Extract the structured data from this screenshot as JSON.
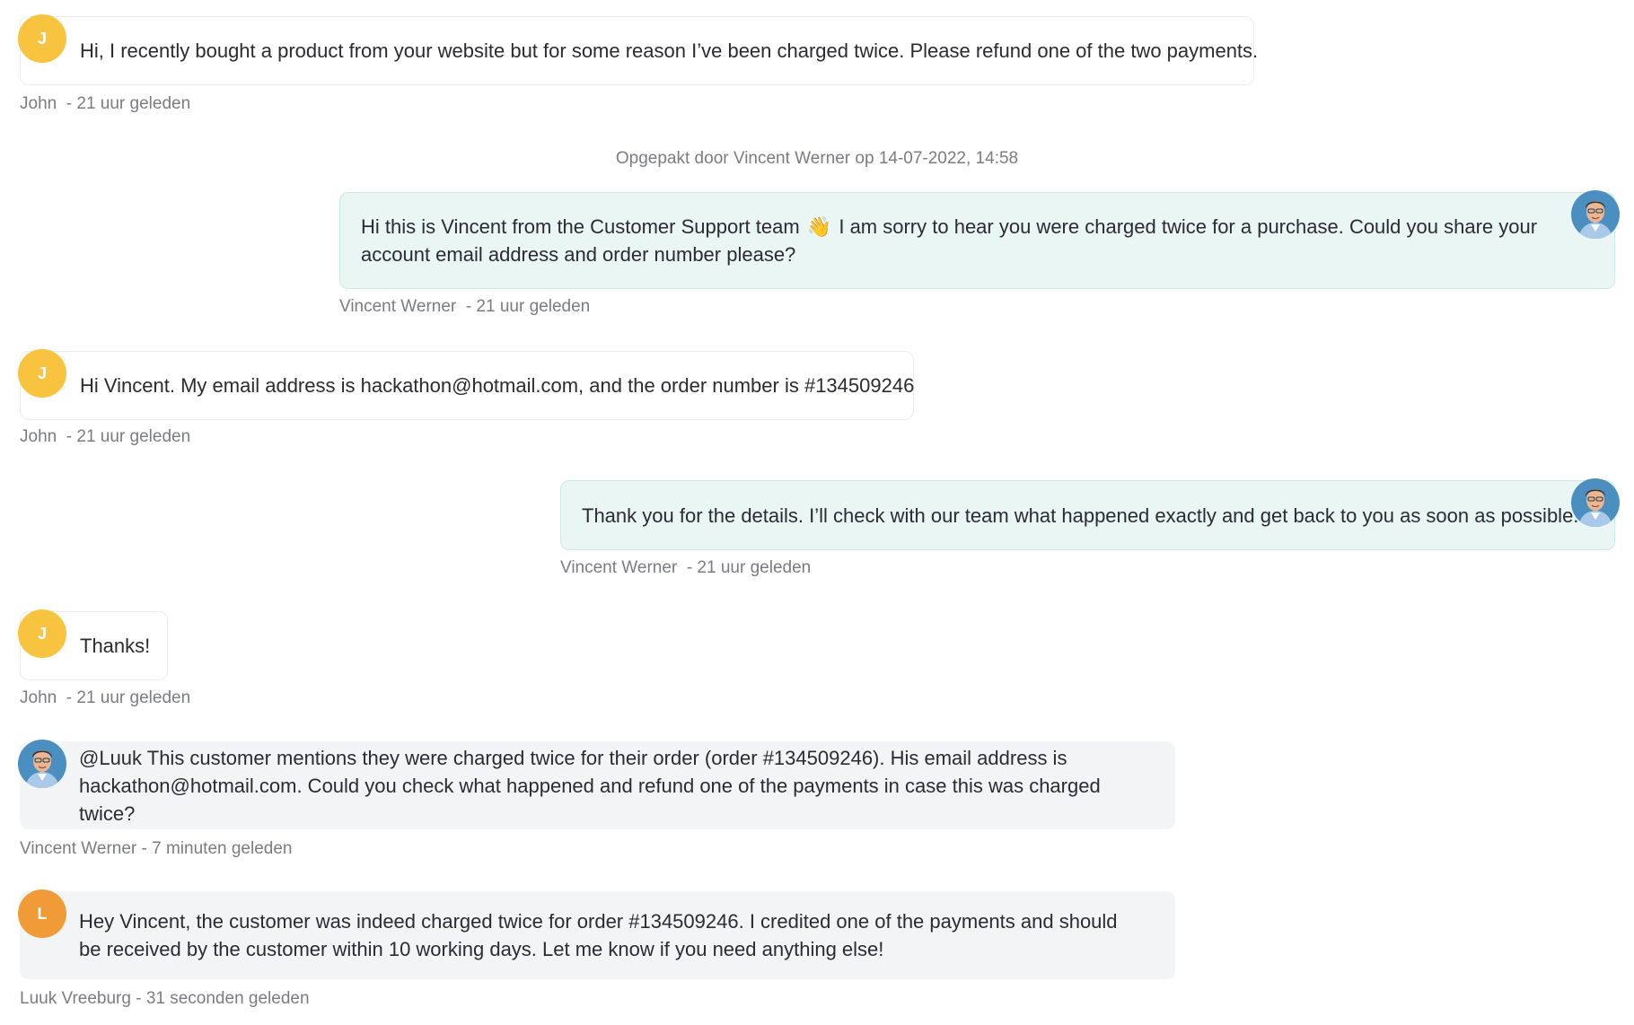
{
  "messages": [
    {
      "text": "Hi, I recently bought a product from your website but for some reason I’ve been charged twice. Please refund one of the two payments.",
      "author": "John",
      "time": "- 21 uur geleden",
      "initial": "J"
    },
    {
      "text_before": "Hi this is Vincent from the Customer Support team",
      "emoji": "👋",
      "text_after": "I am sorry to hear you were charged twice for a purchase. Could you share your account email address and order number please?",
      "author": "Vincent Werner",
      "time": "- 21 uur geleden"
    },
    {
      "text": "Hi Vincent. My email address is hackathon@hotmail.com, and the order number is #134509246",
      "author": "John",
      "time": "- 21 uur geleden",
      "initial": "J"
    },
    {
      "text": "Thank you for the details. I’ll check with our team what happened exactly and get back to you as soon as possible.",
      "author": "Vincent Werner",
      "time": "- 21 uur geleden"
    },
    {
      "text": "Thanks!",
      "author": "John",
      "time": "- 21 uur geleden",
      "initial": "J"
    },
    {
      "text": "@Luuk This customer mentions they were charged twice for their order (order #134509246). His email address is hackathon@hotmail.com. Could you check what happened and refund one of the payments in case this was charged twice?",
      "meta": "Vincent Werner - 7 minuten geleden"
    },
    {
      "text": "Hey Vincent, the customer was indeed charged twice for order #134509246. I credited one of the payments and should be received by the customer within 10 working days. Let me know if you need anything else!",
      "meta": "Luuk Vreeburg - 31 seconden geleden",
      "initial": "L"
    }
  ],
  "system_events": [
    {
      "text": "Opgepakt door Vincent Werner op 14-07-2022, 14:58"
    }
  ],
  "colors": {
    "customer_avatar": "#f8c440",
    "luuk_avatar": "#f19a38",
    "agent_bubble": "#e9f6f3",
    "agent_border": "#cde9e2",
    "internal_bubble": "#f3f4f5",
    "meta_text": "#7a7c82"
  },
  "icons": [
    "agent-avatar-photo"
  ]
}
